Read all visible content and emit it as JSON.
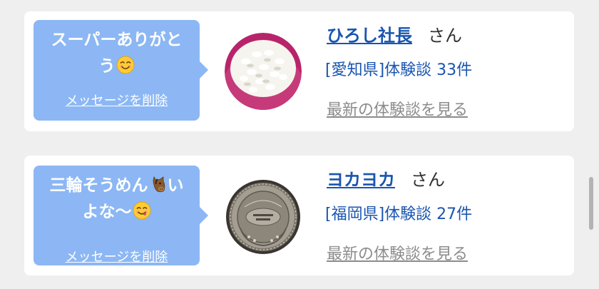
{
  "items": [
    {
      "message": "スーパーありがとう",
      "message_line1": "スーパーありがと",
      "message_line2": "う",
      "emoji": "smiling-face-icon",
      "delete_label": "メッセージを削除",
      "avatar": "rice-bowl-image",
      "user_name": "ひろし社長",
      "honorific": "さん",
      "prefecture": "[愛知県]",
      "stories_label": "体験談 33件",
      "more_label": "最新の体験談を見る"
    },
    {
      "message": "三輪そうめん🐴いよな〜😋",
      "message_part1": "三輪そうめん",
      "message_part2": "い",
      "message_line2": "よな〜",
      "emoji": "horse-face-icon",
      "emoji2": "yum-face-icon",
      "delete_label": "メッセージを削除",
      "avatar": "coin-medal-image",
      "user_name": "ヨカヨカ",
      "honorific": "さん",
      "prefecture": "[福岡県]",
      "stories_label": "体験談 27件",
      "more_label": "最新の体験談を見る"
    }
  ],
  "colors": {
    "bubble": "#8cb7f4",
    "link": "#1a55b0",
    "muted_link": "#8c8c8c",
    "card": "#ffffff",
    "background": "#efefef"
  }
}
